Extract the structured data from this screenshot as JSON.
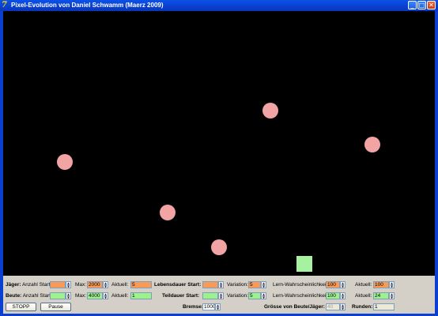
{
  "window": {
    "title": "Pixel-Evolution von Daniel Schwamm (Maerz 2009)",
    "icon": "7",
    "min_glyph": "_",
    "max_glyph": "□",
    "close_glyph": "✕"
  },
  "colors": {
    "predator": "#f2a3a3",
    "prey": "#a7f2a0",
    "canvas": "#000000",
    "field_orange": "#f99b57",
    "field_green": "#9bf28f"
  },
  "controls": {
    "jaeger_label": "Jäger:",
    "beute_label": "Beute:",
    "anzahl_start_label": "Anzahl Start:",
    "max_label": "Max:",
    "aktuell_label": "Aktuell:",
    "jaeger_anzahl_start": "",
    "jaeger_max": "2000",
    "jaeger_aktuell": "5",
    "beute_anzahl_start": "",
    "beute_max": "4000",
    "beute_aktuell": "1",
    "lebensdauer_label": "Lebensdauer Start:",
    "teildauer_label": "Teildauer Start:",
    "variation_label": "Variation:",
    "lebensdauer_start": "",
    "teildauer_start": "",
    "jaeger_variation": "5",
    "beute_variation": "5",
    "lern_label": "Lern-Wahrscheinlichkeit:",
    "jaeger_lern": "100",
    "beute_lern": "100",
    "jaeger_aktuell2": "100",
    "beute_aktuell2": "24",
    "bremse_label": "Bremse:",
    "bremse": "1000",
    "groesse_label": "Grösse von Beute/Jäger:",
    "groesse": "40",
    "runden_label": "Runden:",
    "runden": "1",
    "stopp_button": "STOPP",
    "pause_button": "Pause"
  }
}
